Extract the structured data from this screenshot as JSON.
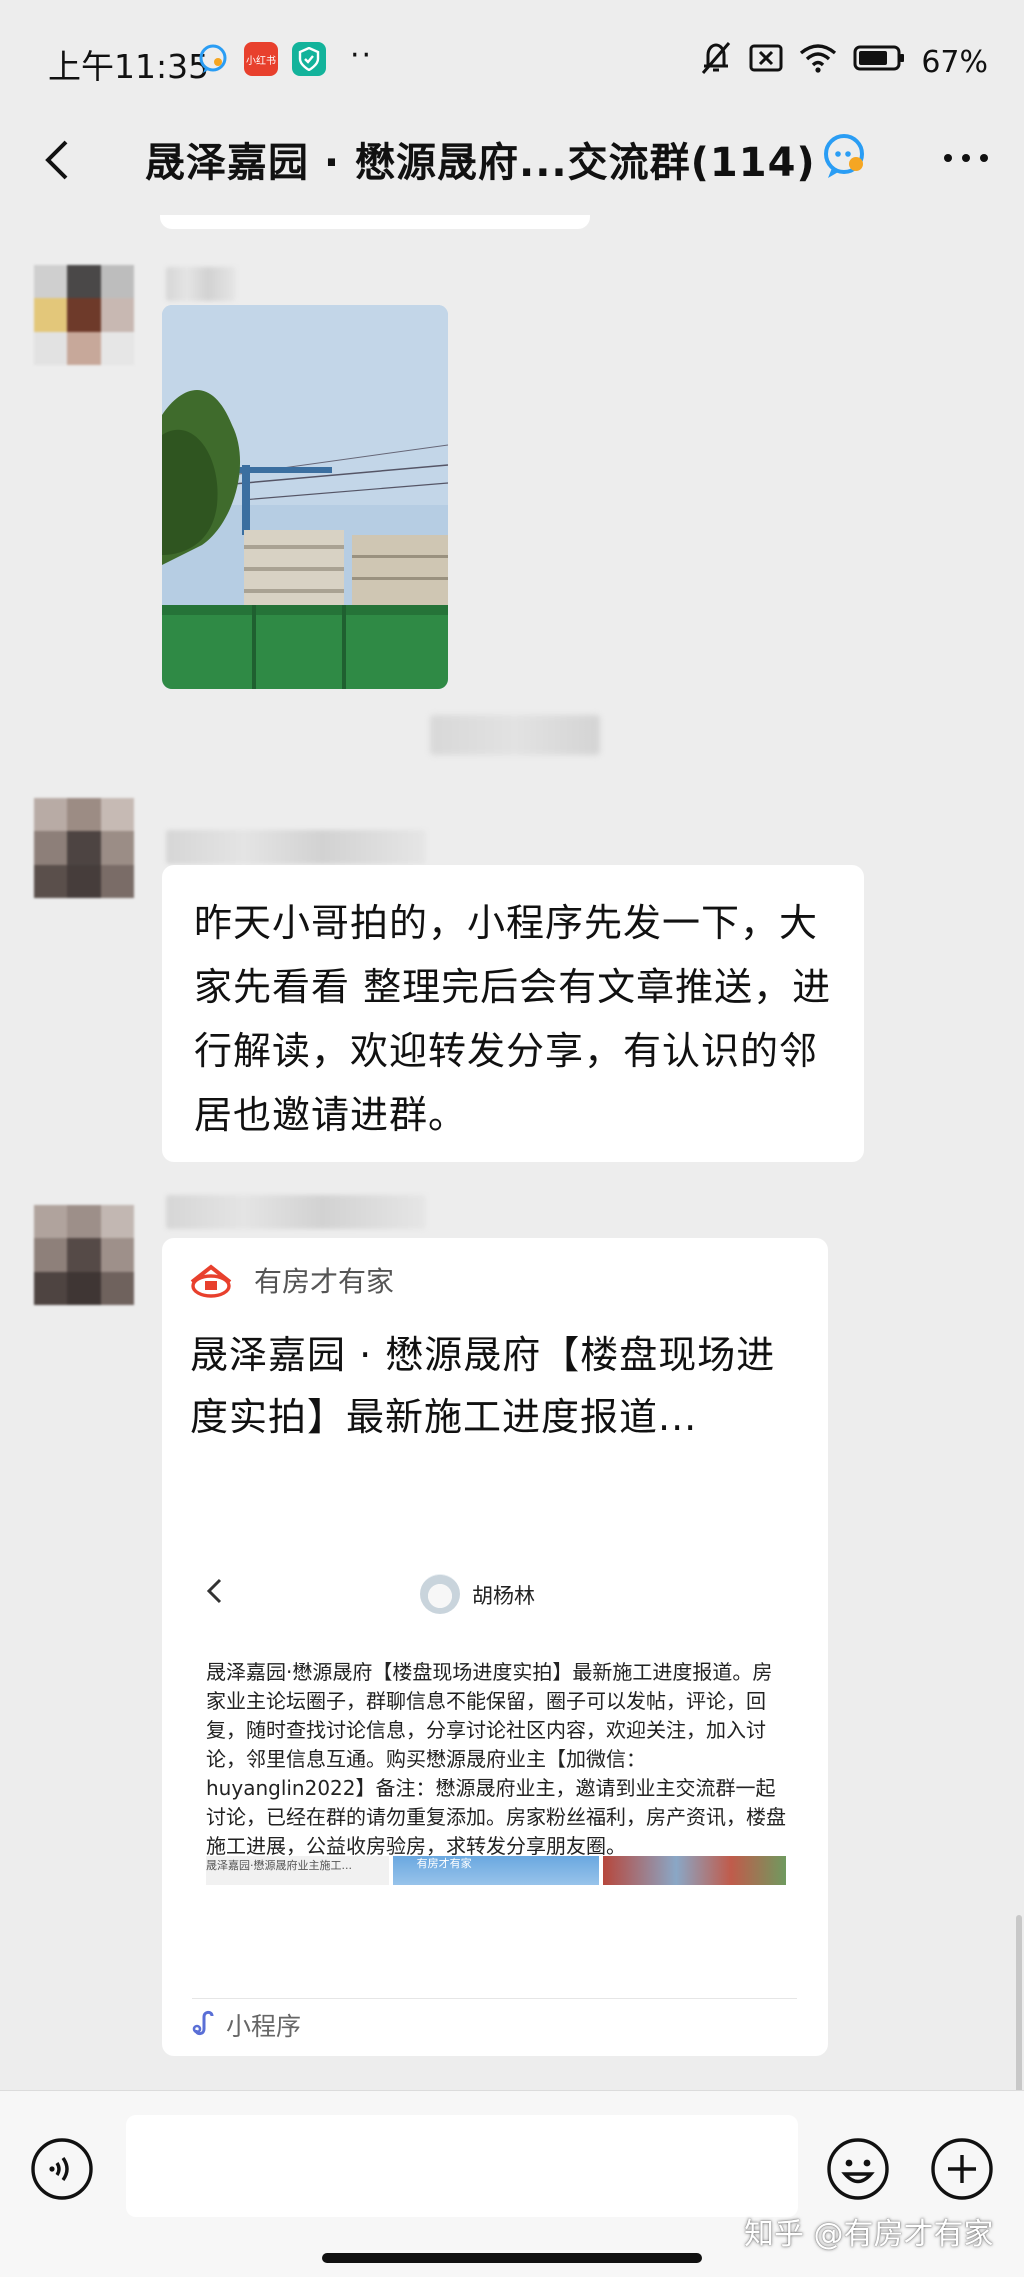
{
  "status_bar": {
    "time": "上午11:35",
    "app_badges": [
      "chat-bubble-icon",
      "xiaohongshu-icon",
      "shield-icon"
    ],
    "app_badge_xhs_text": "小红书",
    "more_notifications": "··",
    "battery": "67%"
  },
  "header": {
    "title": "晟泽嘉园 · 懋源晟府...交流群(114)"
  },
  "messages": {
    "text_message": "昨天小哥拍的，小程序先发一下，大家先看看 整理完后会有文章推送，进行解读，欢迎转发分享，有认识的邻居也邀请进群。",
    "card": {
      "source": "有房才有家",
      "title": "晟泽嘉园 · 懋源晟府【楼盘现场进度实拍】最新施工进度报道...",
      "preview": {
        "author": "胡杨林",
        "body": "晟泽嘉园·懋源晟府【楼盘现场进度实拍】最新施工进度报道。房家业主论坛圈子，群聊信息不能保留，圈子可以发帖，评论，回复，随时查找讨论信息，分享讨论社区内容，欢迎关注，加入讨论，邻里信息互通。购买懋源晟府业主【加微信：huyanglin2022】备注：懋源晟府业主，邀请到业主交流群一起讨论，已经在群的请勿重复添加。房家粉丝福利，房产资讯，楼盘施工进展，公益收房验房，求转发分享朋友圈。",
        "thumb_1_text": "晟泽嘉园·懋源晟府业主施工...",
        "thumb_2_text": "有房才有家"
      },
      "footer_label": "小程序"
    }
  },
  "input_bar": {
    "watermark": "知乎 @有房才有家"
  },
  "colors": {
    "background": "#ededed",
    "bubble": "#ffffff",
    "input_bar": "#f7f7f7",
    "accent_red": "#e8402d"
  }
}
